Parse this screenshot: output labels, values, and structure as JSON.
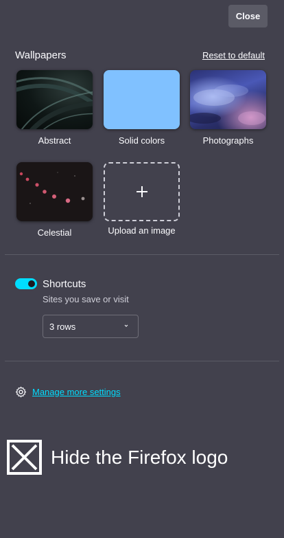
{
  "header": {
    "close_label": "Close"
  },
  "wallpapers": {
    "title": "Wallpapers",
    "reset_label": "Reset to default",
    "items": [
      {
        "label": "Abstract",
        "kind": "abstract"
      },
      {
        "label": "Solid colors",
        "kind": "solid",
        "color": "#80c1ff"
      },
      {
        "label": "Photographs",
        "kind": "photo"
      },
      {
        "label": "Celestial",
        "kind": "celestial"
      }
    ],
    "upload_label": "Upload an image"
  },
  "shortcuts": {
    "enabled": true,
    "label": "Shortcuts",
    "sublabel": "Sites you save or visit",
    "rows_selected": "3 rows"
  },
  "manage": {
    "label": "Manage more settings"
  },
  "hide_logo": {
    "label": "Hide the Firefox logo",
    "checked": false
  },
  "colors": {
    "background": "#42414d",
    "accent": "#00ddff",
    "button": "#5b5b66"
  }
}
